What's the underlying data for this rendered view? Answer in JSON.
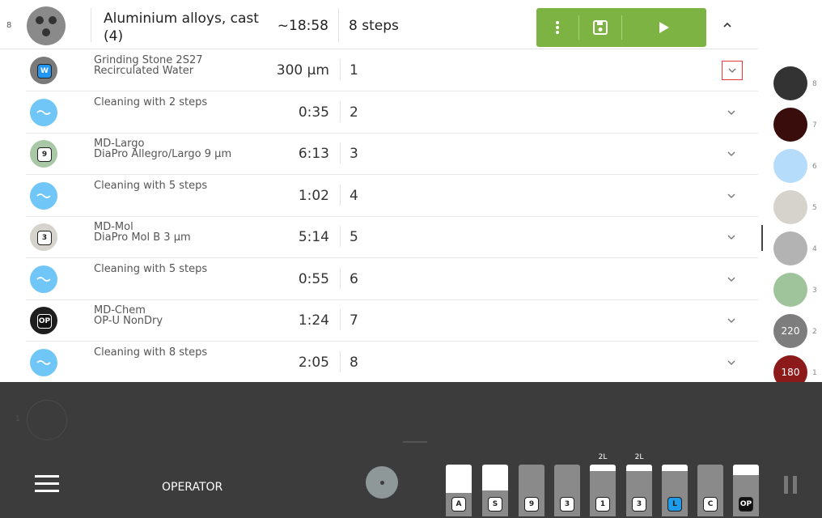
{
  "header": {
    "index": "8",
    "title": "Aluminium alloys, cast (4)",
    "time_symbol": "~",
    "time": "18:58",
    "steps": "8 steps"
  },
  "steps": [
    {
      "line1": "Grinding Stone 2S27",
      "line2": "Recirculated Water",
      "value": "300 µm",
      "number": "1",
      "icon": "water-badge-icon",
      "badge": "W",
      "disc_color": "#7a7a7a",
      "selected": true
    },
    {
      "line1": "Cleaning with 2 steps",
      "line2": "",
      "value": "0:35",
      "number": "2",
      "icon": "cleaning-wave-icon",
      "badge": "",
      "disc_color": "#6fc6f7",
      "selected": false
    },
    {
      "line1": "MD-Largo",
      "line2": "DiaPro Allegro/Largo 9 µm",
      "value": "6:13",
      "number": "3",
      "icon": "largo-disc-icon",
      "badge": "9",
      "disc_color": "#a9c8a6",
      "selected": false
    },
    {
      "line1": "Cleaning with 5 steps",
      "line2": "",
      "value": "1:02",
      "number": "4",
      "icon": "cleaning-wave-icon",
      "badge": "",
      "disc_color": "#6fc6f7",
      "selected": false
    },
    {
      "line1": "MD-Mol",
      "line2": "DiaPro Mol B 3 µm",
      "value": "5:14",
      "number": "5",
      "icon": "mol-disc-icon",
      "badge": "3",
      "disc_color": "#d6d3cc",
      "selected": false
    },
    {
      "line1": "Cleaning with 5 steps",
      "line2": "",
      "value": "0:55",
      "number": "6",
      "icon": "cleaning-wave-icon",
      "badge": "",
      "disc_color": "#6fc6f7",
      "selected": false
    },
    {
      "line1": "MD-Chem",
      "line2": "OP-U NonDry",
      "value": "1:24",
      "number": "7",
      "icon": "chem-disc-icon",
      "badge": "OP",
      "disc_color": "#1e1e1e",
      "selected": false
    },
    {
      "line1": "Cleaning with 8 steps",
      "line2": "",
      "value": "2:05",
      "number": "8",
      "icon": "cleaning-wave-icon",
      "badge": "",
      "disc_color": "#6fc6f7",
      "selected": false
    }
  ],
  "right_discs": [
    {
      "number": "8",
      "label": "",
      "color": "#333333"
    },
    {
      "number": "7",
      "label": "",
      "color": "#3a0d0d"
    },
    {
      "number": "6",
      "label": "",
      "color": "#b5dcfb"
    },
    {
      "number": "5",
      "label": "",
      "color": "#d6d3cc"
    },
    {
      "number": "4",
      "label": "",
      "color": "#b3b3b3"
    },
    {
      "number": "3",
      "label": "",
      "color": "#9fc49b"
    },
    {
      "number": "2",
      "label": "220",
      "color": "#7d7d7d"
    },
    {
      "number": "1",
      "label": "180",
      "color": "#8d1a1a"
    }
  ],
  "bottom": {
    "ghost_index": "1",
    "role": "OPERATOR",
    "bottles": [
      {
        "badge": "A",
        "top_label": "",
        "fill": 0.55
      },
      {
        "badge": "S",
        "top_label": "",
        "fill": 0.5
      },
      {
        "badge": "9",
        "top_label": "",
        "fill": 0.0
      },
      {
        "badge": "3",
        "top_label": "",
        "fill": 0.0
      },
      {
        "badge": "1",
        "top_label": "2L",
        "fill": 0.12
      },
      {
        "badge": "3",
        "top_label": "2L",
        "fill": 0.12
      },
      {
        "badge": "L",
        "top_label": "",
        "fill": 0.12
      },
      {
        "badge": "C",
        "top_label": "",
        "fill": 0.0
      },
      {
        "badge": "OP",
        "top_label": "",
        "fill": 0.2
      }
    ]
  }
}
